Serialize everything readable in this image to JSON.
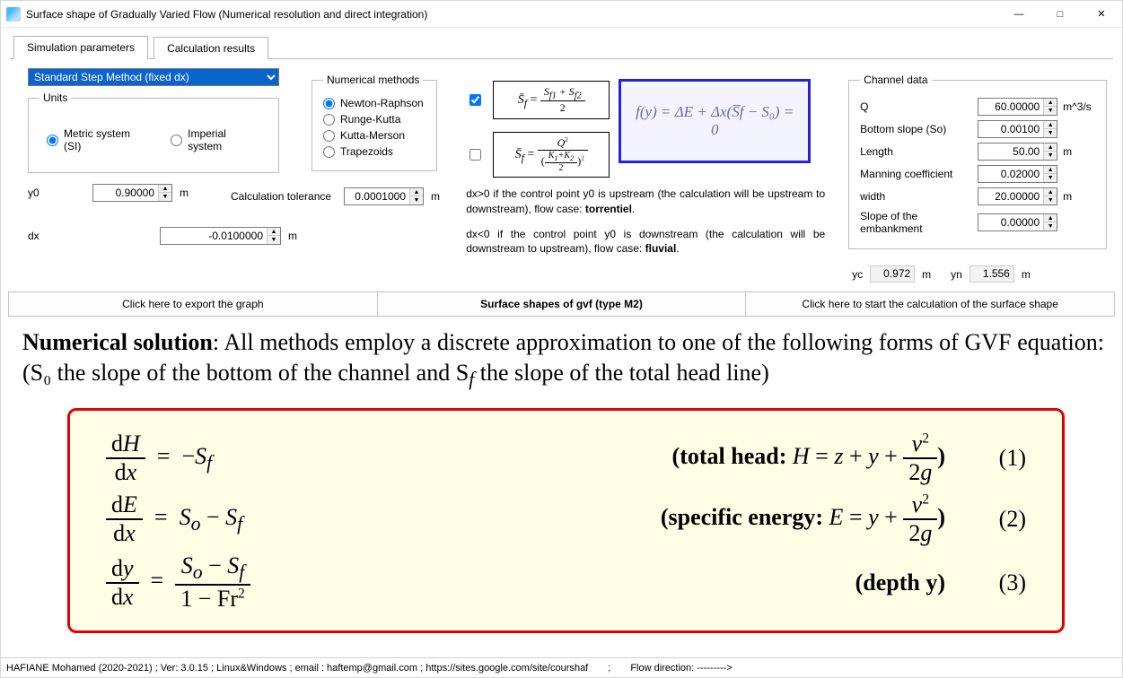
{
  "window": {
    "title": "Surface shape of Gradually Varied Flow (Numerical resolution and direct integration)"
  },
  "tabs": {
    "sim": "Simulation parameters",
    "res": "Calculation results"
  },
  "method_select": "Standard Step Method (fixed dx)",
  "units": {
    "legend": "Units",
    "metric": "Metric system (SI)",
    "imperial": "Imperial system"
  },
  "y0": {
    "label": "y0",
    "value": "0.90000",
    "unit": "m"
  },
  "dx": {
    "label": "dx",
    "value": "-0.0100000",
    "unit": "m"
  },
  "calc_tol": {
    "label": "Calculation tolerance",
    "value": "0.0001000",
    "unit": "m"
  },
  "num_methods": {
    "legend": "Numerical methods",
    "nr": "Newton-Raphson",
    "rk": "Runge-Kutta",
    "km": "Kutta-Merson",
    "tr": "Trapezoids"
  },
  "blue_formula": "f(y) = ΔE + Δx(S̅f − S₀) = 0",
  "dx_note1_a": "dx>0 if the control point y0 is upstream (the calculation will be upstream to downstream), flow case: ",
  "dx_note1_b": "torrentiel",
  "dx_note2_a": "dx<0 if the control point y0 is downstream (the calculation will be downstream to upstream), flow case: ",
  "dx_note2_b": "fluvial",
  "channel": {
    "legend": "Channel data",
    "Q": {
      "label": "Q",
      "value": "60.00000",
      "unit": "m^3/s"
    },
    "So": {
      "label": "Bottom slope (So)",
      "value": "0.00100"
    },
    "L": {
      "label": "Length",
      "value": "50.00",
      "unit": "m"
    },
    "n": {
      "label": "Manning coefficient",
      "value": "0.02000"
    },
    "w": {
      "label": "width",
      "value": "20.00000",
      "unit": "m"
    },
    "emb": {
      "label": "Slope of the embankment",
      "value": "0.00000"
    }
  },
  "yc": {
    "label": "yc",
    "value": "0.972",
    "unit": "m"
  },
  "yn": {
    "label": "yn",
    "value": "1.556",
    "unit": "m"
  },
  "actions": {
    "export": "Click here to export the graph",
    "title": "Surface shapes of gvf (type M2)",
    "start": "Click here to start the calculation of the surface shape"
  },
  "lower": {
    "intro_bold": "Numerical solution",
    "intro_rest": ": All methods employ a discrete approximation to one of the following forms of GVF equation: (S₀ the slope of the bottom of the channel and S",
    "intro_rest2": " the slope of the total head line)",
    "eq1_desc_a": "(total head: ",
    "eq1_desc_b": ")",
    "eq2_desc_a": "(specific energy: ",
    "eq2_desc_b": ")",
    "eq3_desc": "(depth y)",
    "n1": "(1)",
    "n2": "(2)",
    "n3": "(3)"
  },
  "status": {
    "left": "HAFIANE Mohamed (2020-2021) ; Ver: 3.0.15 ; Linux&Windows ; email : haftemp@gmail.com ; https://sites.google.com/site/courshaf",
    "sep": ";",
    "flow": "Flow direction: --------->"
  }
}
